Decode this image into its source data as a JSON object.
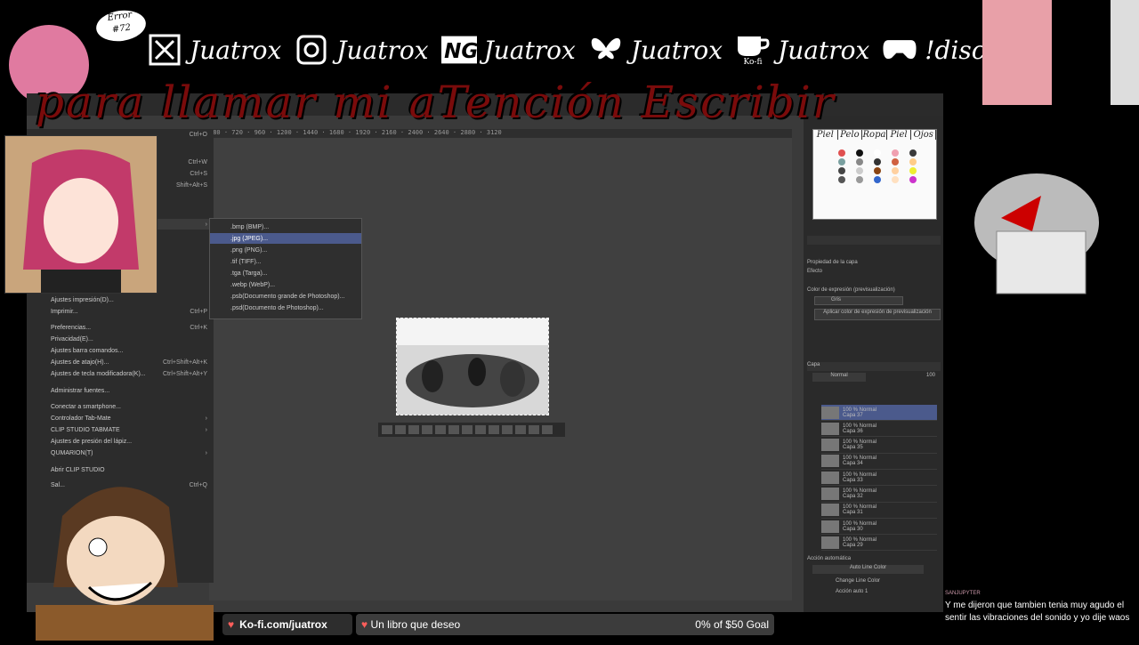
{
  "overlay": {
    "error_line1": "Error",
    "error_line2": "#72",
    "headline": "para llamar mi aTención Escribir",
    "socials": [
      {
        "icon": "x-icon",
        "label": "Juatrox"
      },
      {
        "icon": "instagram-icon",
        "label": "Juatrox"
      },
      {
        "icon": "newgrounds-icon",
        "label": "Juatrox"
      },
      {
        "icon": "bluesky-butterfly-icon",
        "label": "Juatrox"
      },
      {
        "icon": "kofi-cup-icon",
        "label": "Juatrox",
        "sub": "Ko-fi"
      },
      {
        "icon": "gamepad-icon",
        "label": "!discord"
      }
    ]
  },
  "file_menu": {
    "items": [
      {
        "label": "Ajustes impresión(D)...",
        "shortcut": ""
      },
      {
        "label": "Imprimir...",
        "shortcut": "Ctrl+P"
      },
      {
        "label": "Preferencias...",
        "shortcut": "Ctrl+K"
      },
      {
        "label": "Privacidad(E)...",
        "shortcut": ""
      },
      {
        "label": "Ajustes barra comandos...",
        "shortcut": ""
      },
      {
        "label": "Ajustes de atajo(H)...",
        "shortcut": "Ctrl+Shift+Alt+K"
      },
      {
        "label": "Ajustes de tecla modificadora(K)...",
        "shortcut": "Ctrl+Shift+Alt+Y"
      },
      {
        "label": "Administrar fuentes...",
        "shortcut": ""
      },
      {
        "label": "Conectar a smartphone...",
        "shortcut": ""
      },
      {
        "label": "Controlador Tab-Mate",
        "shortcut": "›"
      },
      {
        "label": "CLIP STUDIO TABMATE",
        "shortcut": "›"
      },
      {
        "label": "Ajustes de presión del lápiz...",
        "shortcut": ""
      },
      {
        "label": "QUMARION(T)",
        "shortcut": "›"
      },
      {
        "label": "Abrir CLIP STUDIO",
        "shortcut": ""
      },
      {
        "label": "Sal...",
        "shortcut": "Ctrl+Q"
      }
    ],
    "top_shortcuts": [
      "Ctrl+O",
      "Ctrl+W",
      "Ctrl+S",
      "Shift+Alt+S"
    ]
  },
  "export_submenu": [
    {
      "label": ".bmp (BMP)...",
      "highlighted": false
    },
    {
      "label": ".jpg (JPEG)...",
      "highlighted": true
    },
    {
      "label": ".png (PNG)...",
      "highlighted": false
    },
    {
      "label": ".tif (TIFF)...",
      "highlighted": false
    },
    {
      "label": ".tga (Targa)...",
      "highlighted": false
    },
    {
      "label": ".webp (WebP)...",
      "highlighted": false
    },
    {
      "label": ".psb(Documento grande de Photoshop)...",
      "highlighted": false
    },
    {
      "label": ".psd(Documento de Photoshop)...",
      "highlighted": false
    }
  ],
  "ruler_text": "480 · 720 · 960 · 1200 · 1440 · 1680 · 1920 · 2160 · 2400 · 2640 · 2880 · 3120",
  "palette_header": [
    "Piel",
    "Pelo",
    "Ropa",
    "Piel",
    "Ojos"
  ],
  "palette_colors": [
    "#e05050",
    "#111111",
    "#ffffff",
    "#f0a0b0",
    "#3a3a3a",
    "#7aa0a0",
    "#888888",
    "#333333",
    "#d06040",
    "#ffcc88",
    "#444444",
    "#cccccc",
    "#8b4513",
    "#ffd0a0",
    "#eeee33",
    "#555555",
    "#999999",
    "#3366cc",
    "#ffe0c0",
    "#cc33cc"
  ],
  "right_panel": {
    "property_title": "Propiedad de la capa",
    "effect_label": "Efecto",
    "expression_label": "Color de expresión (previsualización)",
    "gray_value": "Gris",
    "apply_button": "Aplicar color de expresión de previsualización",
    "layer_tab": "Capa",
    "blend_mode": "Normal",
    "opacity": "100",
    "action_title": "Acción automática",
    "action_set": "Auto Line Color",
    "action_1": "Change Line Color",
    "action_2": "Acción auto 1"
  },
  "layers": [
    {
      "opacity": "100 % Normal",
      "name": "Capa 37",
      "selected": true
    },
    {
      "opacity": "100 % Normal",
      "name": "Capa 36",
      "selected": false
    },
    {
      "opacity": "100 % Normal",
      "name": "Capa 35",
      "selected": false
    },
    {
      "opacity": "100 % Normal",
      "name": "Capa 34",
      "selected": false
    },
    {
      "opacity": "100 % Normal",
      "name": "Capa 33",
      "selected": false
    },
    {
      "opacity": "100 % Normal",
      "name": "Capa 32",
      "selected": false
    },
    {
      "opacity": "100 % Normal",
      "name": "Capa 31",
      "selected": false
    },
    {
      "opacity": "100 % Normal",
      "name": "Capa 30",
      "selected": false
    },
    {
      "opacity": "100 % Normal",
      "name": "Capa 29",
      "selected": false
    }
  ],
  "bottom_bar": {
    "kofi_text": "Ko-fi.com/juatrox",
    "goal_name": "Un libro que deseo",
    "goal_progress": "0% of $50 Goal"
  },
  "chat": {
    "username": "SANJUPYTER",
    "message": "Y me dijeron que tambien tenia muy agudo el sentir las vibraciones del sonido y yo dije waos"
  }
}
